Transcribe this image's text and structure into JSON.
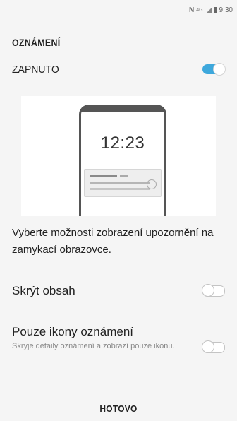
{
  "status_bar": {
    "nfc": "N",
    "network": "4G",
    "time": "9:30"
  },
  "header": {
    "title": "OZNÁMENÍ"
  },
  "master": {
    "label": "ZAPNUTO",
    "enabled": true,
    "accent_color": "#3ea8dc"
  },
  "preview": {
    "clock": "12:23"
  },
  "description": "Vyberte možnosti zobrazení upozornění na zamykací obrazovce.",
  "options": {
    "hide_content": {
      "label": "Skrýt obsah",
      "enabled": false
    },
    "icons_only": {
      "label": "Pouze ikony oznámení",
      "subtitle": "Skryje detaily oznámení a zobrazí pouze ikonu.",
      "enabled": false
    }
  },
  "footer": {
    "done_label": "HOTOVO"
  }
}
